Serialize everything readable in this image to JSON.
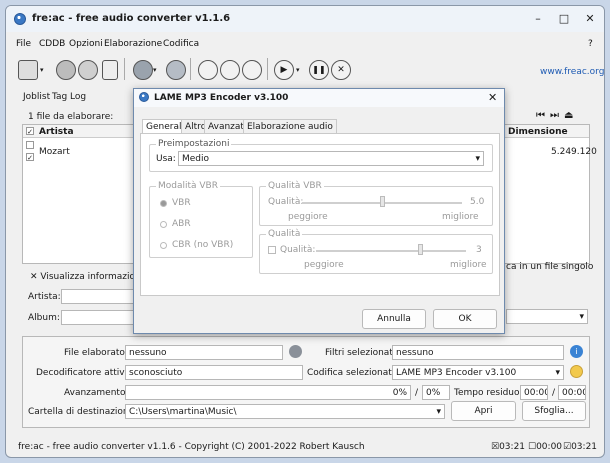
{
  "window": {
    "title": "fre:ac - free audio converter v1.1.6",
    "help": "?"
  },
  "menu": [
    "File",
    "CDDB",
    "Opzioni",
    "Elaborazione",
    "Codifica"
  ],
  "toolbar": {
    "link": "www.freac.org"
  },
  "tabs": [
    "Joblist",
    "Tag",
    "Log"
  ],
  "joblist": {
    "count_label": "1 file da elaborare:",
    "col_artist": "Artista",
    "col_size": "Dimensione",
    "row": {
      "artist": "Mozart",
      "size": "5.249.120"
    },
    "show_info": "Visualizza informazioni",
    "single_file": "ca in un file singolo",
    "artist_label": "Artista:",
    "album_label": "Album:"
  },
  "info": {
    "file_label": "File elaborato:",
    "file_value": "nessuno",
    "filters_label": "Filtri selezionati:",
    "filters_value": "nessuno",
    "decoder_label": "Decodificatore attivo:",
    "decoder_value": "sconosciuto",
    "encoder_label": "Codifica selezionata:",
    "encoder_value": "LAME MP3 Encoder v3.100",
    "progress_label": "Avanzamento:",
    "progress_pct1": "0%",
    "progress_pct2": "0%",
    "time_label": "Tempo residuo:",
    "time1": "00:00",
    "time2": "00:00",
    "dest_label": "Cartella di destinazione:",
    "dest_value": "C:\\Users\\martina\\Music\\",
    "open_btn": "Apri",
    "browse_btn": "Sfoglia..."
  },
  "statusbar": {
    "text": "fre:ac - free audio converter v1.1.6 - Copyright (C) 2001-2022 Robert Kausch",
    "t1": "03:21",
    "t2": "00:00",
    "t3": "03:21"
  },
  "dialog": {
    "title": "LAME MP3 Encoder v3.100",
    "tabs": [
      "Generale",
      "Altro",
      "Avanzate",
      "Elaborazione audio"
    ],
    "presets_group": "Preimpostazioni",
    "use_label": "Usa:",
    "use_value": "Medio",
    "vbr_group": "Modalità VBR",
    "vbr_options": [
      "VBR",
      "ABR",
      "CBR (no VBR)"
    ],
    "vbr_quality_group": "Qualità VBR",
    "vbr_quality_label": "Qualità:",
    "vbr_quality_value": "5.0",
    "worse": "peggiore",
    "better": "migliore",
    "quality_group": "Qualità",
    "quality_label": "Qualità:",
    "quality_value": "3",
    "cancel_btn": "Annulla",
    "ok_btn": "OK"
  }
}
